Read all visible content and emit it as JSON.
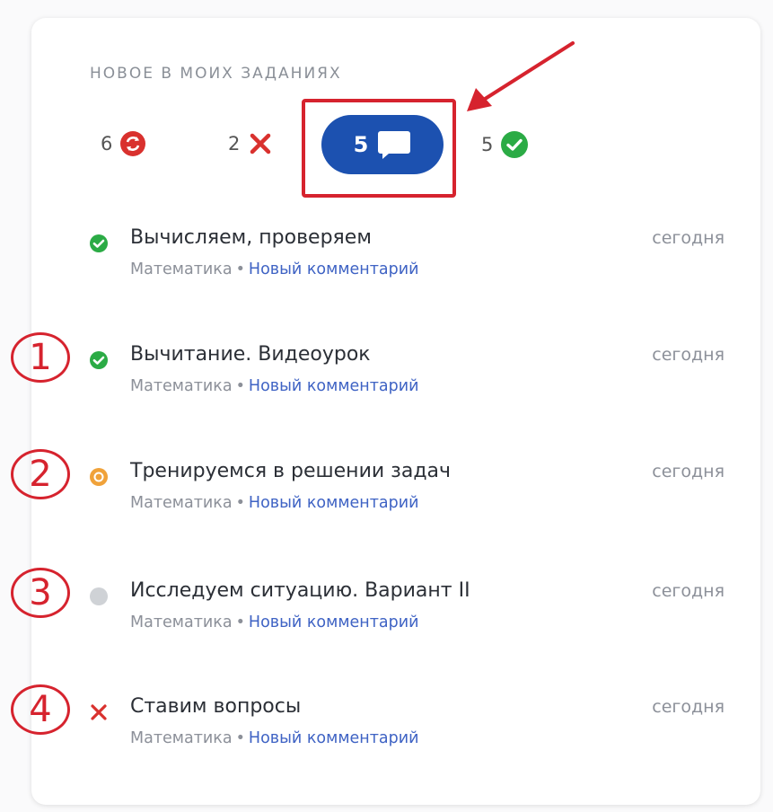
{
  "header": {
    "section_title": "НОВОЕ В МОИХ ЗАДАНИЯХ"
  },
  "counters": {
    "refresh": {
      "count": "6",
      "icon": "refresh-icon",
      "color": "#d9312e"
    },
    "rejected": {
      "count": "2",
      "icon": "cross-icon",
      "color": "#d9312e"
    },
    "comments": {
      "count": "5",
      "icon": "comment-icon",
      "color": "#1c51b0"
    },
    "done": {
      "count": "5",
      "icon": "check-circle-icon",
      "color": "#2bab45"
    }
  },
  "tasks": [
    {
      "title": "Вычисляем, проверяем",
      "subject": "Математика",
      "separator": "•",
      "link": "Новый комментарий",
      "date": "сегодня",
      "status_icon": "check-circle-icon",
      "status_color": "#2bab45"
    },
    {
      "title": "Вычитание. Видеоурок",
      "subject": "Математика",
      "separator": "•",
      "link": "Новый комментарий",
      "date": "сегодня",
      "status_icon": "check-circle-icon",
      "status_color": "#2bab45"
    },
    {
      "title": "Тренируемся в решении задач",
      "subject": "Математика",
      "separator": "•",
      "link": "Новый комментарий",
      "date": "сегодня",
      "status_icon": "pending-circle-icon",
      "status_color": "#f0a23a"
    },
    {
      "title": "Исследуем ситуацию. Вариант II",
      "subject": "Математика",
      "separator": "•",
      "link": "Новый комментарий",
      "date": "сегодня",
      "status_icon": "grey-dot-icon",
      "status_color": "#cfd2d6"
    },
    {
      "title": "Ставим вопросы",
      "subject": "Математика",
      "separator": "•",
      "link": "Новый комментарий",
      "date": "сегодня",
      "status_icon": "cross-icon",
      "status_color": "#d9312e"
    }
  ],
  "annotations": {
    "markers": [
      "1",
      "2",
      "3",
      "4"
    ],
    "highlight_color": "#d6232e"
  }
}
